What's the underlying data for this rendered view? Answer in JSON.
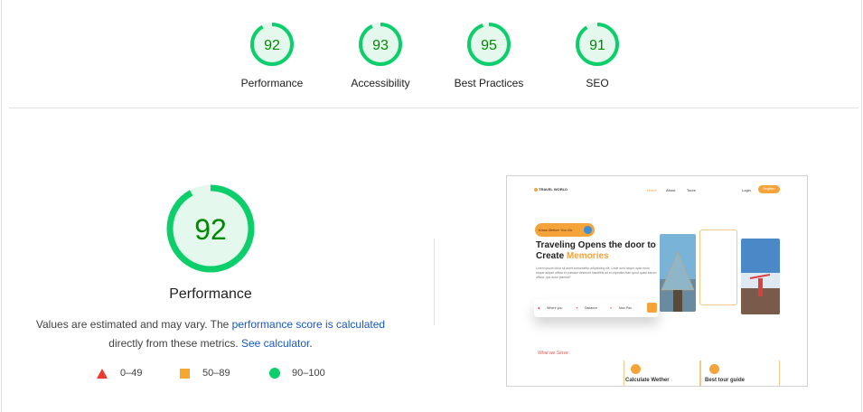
{
  "categories": [
    {
      "label": "Performance",
      "score": "92"
    },
    {
      "label": "Accessibility",
      "score": "93"
    },
    {
      "label": "Best Practices",
      "score": "95"
    },
    {
      "label": "SEO",
      "score": "91"
    }
  ],
  "main": {
    "score": "92",
    "title": "Performance",
    "desc_pre": "Values are estimated and may vary. The ",
    "desc_link1": "performance score is calculated",
    "desc_mid": "directly from these metrics. ",
    "desc_link2": "See calculator",
    "desc_post": "."
  },
  "legend": [
    {
      "range": "0–49",
      "color": "#eb3b2f"
    },
    {
      "range": "50–89",
      "color": "#f6a72f"
    },
    {
      "range": "90–100",
      "color": "#0cce6b"
    }
  ],
  "colors": {
    "pass": "#0cce6b",
    "pass_text": "#008800",
    "pass_fill": "#e5f8ee",
    "accent": "#f5a33b"
  },
  "screenshot": {
    "logo": "TRAVEL WORLD",
    "nav": [
      "Home",
      "About",
      "Tours"
    ],
    "login": "Login",
    "signup": "Register",
    "pill": "Know Before You Go",
    "heading_line1": "Traveling Opens the door to",
    "heading_line2_pre": "Create ",
    "heading_line2_hl": "Memories",
    "paragraph": "Lorem ipsum dolor sit amet consectetur adipisicing elit. Unde sunt neque optio enim eaque aliquid officia ex pariatur deserunt blanditiis ad et expedita illum quod quasi earum officia, quo dolor placeat?",
    "search": [
      "Where you",
      "Distance",
      "Max Pax"
    ],
    "serve": "What we Serve",
    "cards": [
      "Calculate Wether",
      "Best tour guide"
    ]
  }
}
